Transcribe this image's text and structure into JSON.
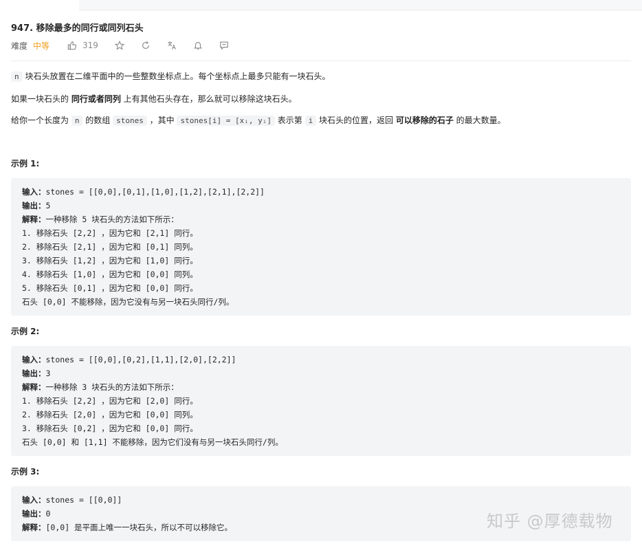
{
  "problem": {
    "title": "947. 移除最多的同行或同列石头",
    "difficulty_label": "难度",
    "difficulty_value": "中等",
    "likes": "319"
  },
  "description": {
    "p1_code": "n",
    "p1_text": " 块石头放置在二维平面中的一些整数坐标点上。每个坐标点上最多只能有一块石头。",
    "p2_a": "如果一块石头的 ",
    "p2_bold": "同行或者同列",
    "p2_b": " 上有其他石头存在，那么就可以移除这块石头。",
    "p3_a": "给你一个长度为 ",
    "p3_code1": "n",
    "p3_b": " 的数组 ",
    "p3_code2": "stones",
    "p3_c": " ，其中 ",
    "p3_code3": "stones[i] = [xᵢ, yᵢ]",
    "p3_d": " 表示第 ",
    "p3_code4": "i",
    "p3_e": " 块石头的位置，返回 ",
    "p3_bold": "可以移除的石子",
    "p3_f": " 的最大数量。"
  },
  "examples": [
    {
      "heading": "示例 1:",
      "input_label": "输入：",
      "input": "stones = [[0,0],[0,1],[1,0],[1,2],[2,1],[2,2]]",
      "output_label": "输出：",
      "output": "5",
      "explain_label": "解释：",
      "explain": "一种移除 5 块石头的方法如下所示：",
      "lines": [
        "1. 移除石头 [2,2] ，因为它和 [2,1] 同行。",
        "2. 移除石头 [2,1] ，因为它和 [0,1] 同列。",
        "3. 移除石头 [1,2] ，因为它和 [1,0] 同行。",
        "4. 移除石头 [1,0] ，因为它和 [0,0] 同列。",
        "5. 移除石头 [0,1] ，因为它和 [0,0] 同行。",
        "石头 [0,0] 不能移除，因为它没有与另一块石头同行/列。"
      ]
    },
    {
      "heading": "示例 2:",
      "input_label": "输入：",
      "input": "stones = [[0,0],[0,2],[1,1],[2,0],[2,2]]",
      "output_label": "输出：",
      "output": "3",
      "explain_label": "解释：",
      "explain": "一种移除 3 块石头的方法如下所示：",
      "lines": [
        "1. 移除石头 [2,2] ，因为它和 [2,0] 同行。",
        "2. 移除石头 [2,0] ，因为它和 [0,0] 同列。",
        "3. 移除石头 [0,2] ，因为它和 [0,0] 同行。",
        "石头 [0,0] 和 [1,1] 不能移除，因为它们没有与另一块石头同行/列。"
      ]
    },
    {
      "heading": "示例 3:",
      "input_label": "输入：",
      "input": "stones = [[0,0]]",
      "output_label": "输出：",
      "output": "0",
      "explain_label": "解释：",
      "explain": "[0,0] 是平面上唯一一块石头，所以不可以移除它。",
      "lines": []
    }
  ],
  "watermark": "知乎 @厚德载物",
  "icons": [
    "thumbs-up-icon",
    "star-icon",
    "refresh-icon",
    "translate-icon",
    "bell-icon",
    "comment-icon"
  ],
  "colors": {
    "difficulty_medium": "#f0a020",
    "code_bg": "#f3f4f6"
  }
}
